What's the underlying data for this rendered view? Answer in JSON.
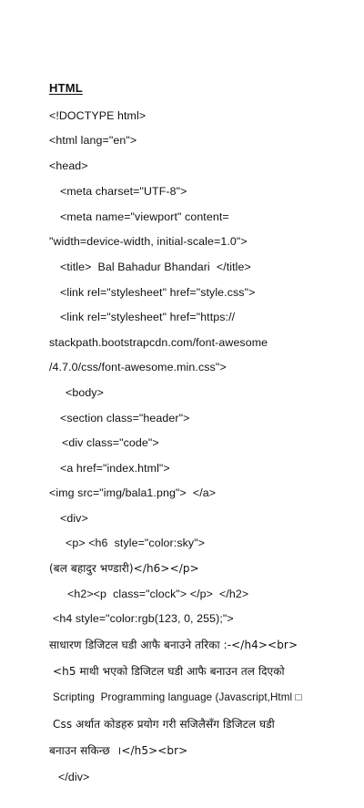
{
  "document": {
    "heading": "HTML",
    "lines": [
      "<!DOCTYPE html>",
      "<html lang=\"en\">",
      "<head>",
      "<meta charset=\"UTF-8\">",
      "<meta name=\"viewport\" content=",
      "\"width=device-width, initial-scale=1.0\">",
      "<title>  Bal Bahadur Bhandari  </title>",
      "<link rel=\"stylesheet\" href=\"style.css\">",
      "<link rel=\"stylesheet\" href=\"https://",
      "stackpath.bootstrapcdn.com/font-awesome",
      "/4.7.0/css/font-awesome.min.css\">",
      "<body>",
      "<section class=\"header\">",
      "<div class=\"code\">",
      "<a href=\"index.html\">",
      "<img src=\"img/bala1.png\">  </a>",
      "<div>",
      "<p> <h6  style=\"color:sky\">",
      "(बल बहादुर भण्डारी)</h6></p>",
      "<h2><p  class=\"clock\"> </p>  </h2>",
      "<h4 style=\"color:rgb(123, 0, 255);\">",
      "साधारण डिजिटल घडी आफै बनाउने तरिका :-</h4><br>",
      "<h5 माथी भएको डिजिटल घडी आफै बनाउन तल दिएको",
      "Scripting  Programming language (Javascript,Html □",
      "Css अर्थात कोडहरु प्रयोग गरी सजिलैसँग डिजिटल घडी",
      "बनाउन सकिन्छ  ।</h5><br>",
      "</div>"
    ]
  }
}
